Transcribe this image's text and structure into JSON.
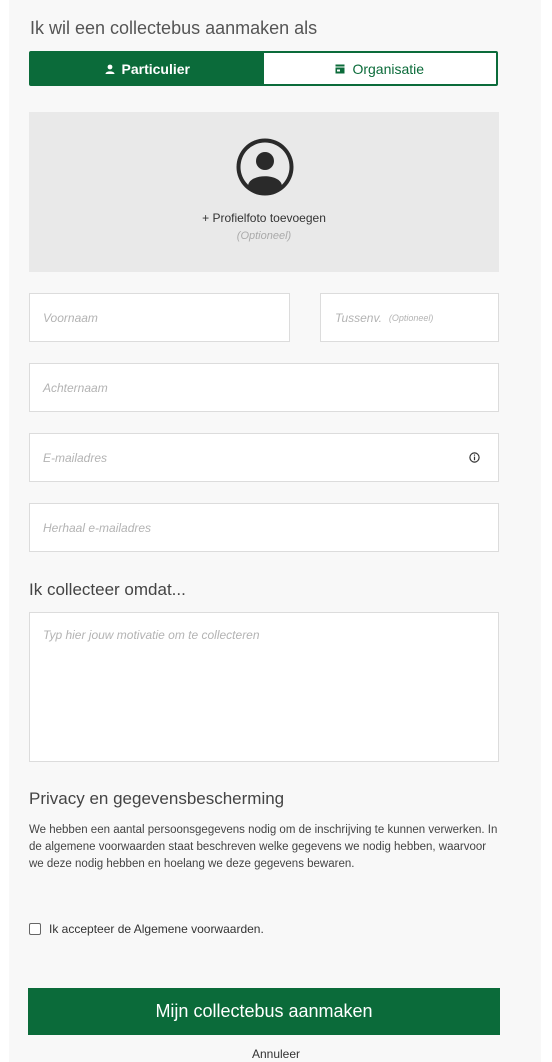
{
  "header": {
    "title": "Ik wil een collectebus aanmaken als"
  },
  "toggle": {
    "particulier": "Particulier",
    "organisatie": "Organisatie"
  },
  "photo": {
    "add_label": "+ Profielfoto toevoegen",
    "optional": "(Optioneel)"
  },
  "form": {
    "voornaam_placeholder": "Voornaam",
    "tussenv_placeholder": "Tussenv.",
    "tussenv_optional": "(Optioneel)",
    "achternaam_placeholder": "Achternaam",
    "email_placeholder": "E-mailadres",
    "email_repeat_placeholder": "Herhaal e-mailadres"
  },
  "motivation": {
    "heading": "Ik collecteer omdat...",
    "placeholder": "Typ hier jouw motivatie om te collecteren"
  },
  "privacy": {
    "heading": "Privacy en gegevensbescherming",
    "text": "We hebben een aantal persoonsgegevens nodig om de inschrijving te kunnen verwerken. In de algemene voorwaarden staat beschreven welke gegevens we nodig hebben, waarvoor we deze nodig hebben en hoelang we deze gegevens bewaren.",
    "accept_label": "Ik accepteer de Algemene voorwaarden.",
    "accept_checked": false
  },
  "actions": {
    "submit": "Mijn collectebus aanmaken",
    "cancel": "Annuleer"
  },
  "colors": {
    "accent": "#0b6b3a"
  }
}
